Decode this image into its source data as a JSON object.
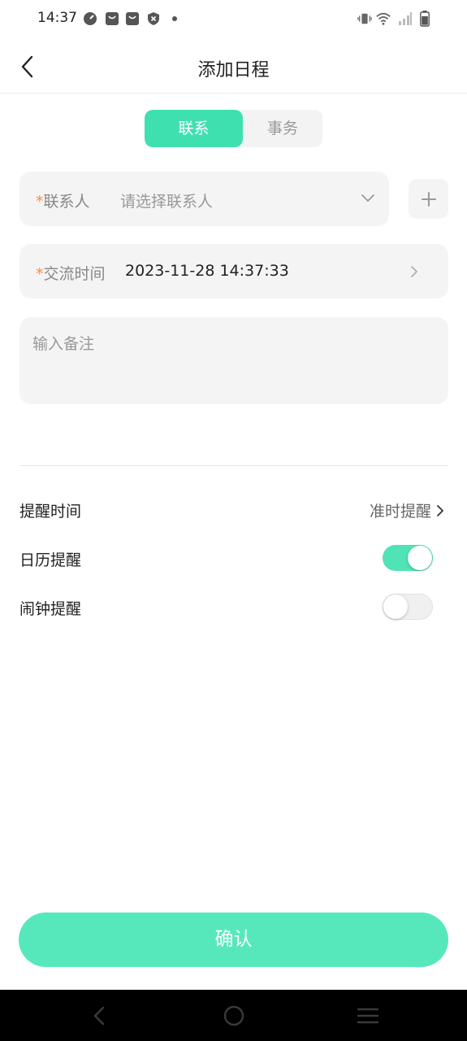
{
  "status_bar": {
    "time": "14:37"
  },
  "header": {
    "title": "添加日程"
  },
  "tabs": [
    {
      "label": "联系",
      "active": true
    },
    {
      "label": "事务",
      "active": false
    }
  ],
  "form": {
    "contact": {
      "required_mark": "*",
      "label": "联系人",
      "placeholder": "请选择联系人"
    },
    "time": {
      "required_mark": "*",
      "label": "交流时间",
      "value": "2023-11-28 14:37:33"
    },
    "remark": {
      "placeholder": "输入备注"
    }
  },
  "settings": {
    "reminder_time": {
      "label": "提醒时间",
      "value": "准时提醒"
    },
    "calendar_reminder": {
      "label": "日历提醒",
      "on": true
    },
    "alarm_reminder": {
      "label": "闹钟提醒",
      "on": false
    }
  },
  "confirm_label": "确认",
  "colors": {
    "accent": "#3fe0b0",
    "confirm": "#56e8bb",
    "required": "#ff8a3d"
  }
}
